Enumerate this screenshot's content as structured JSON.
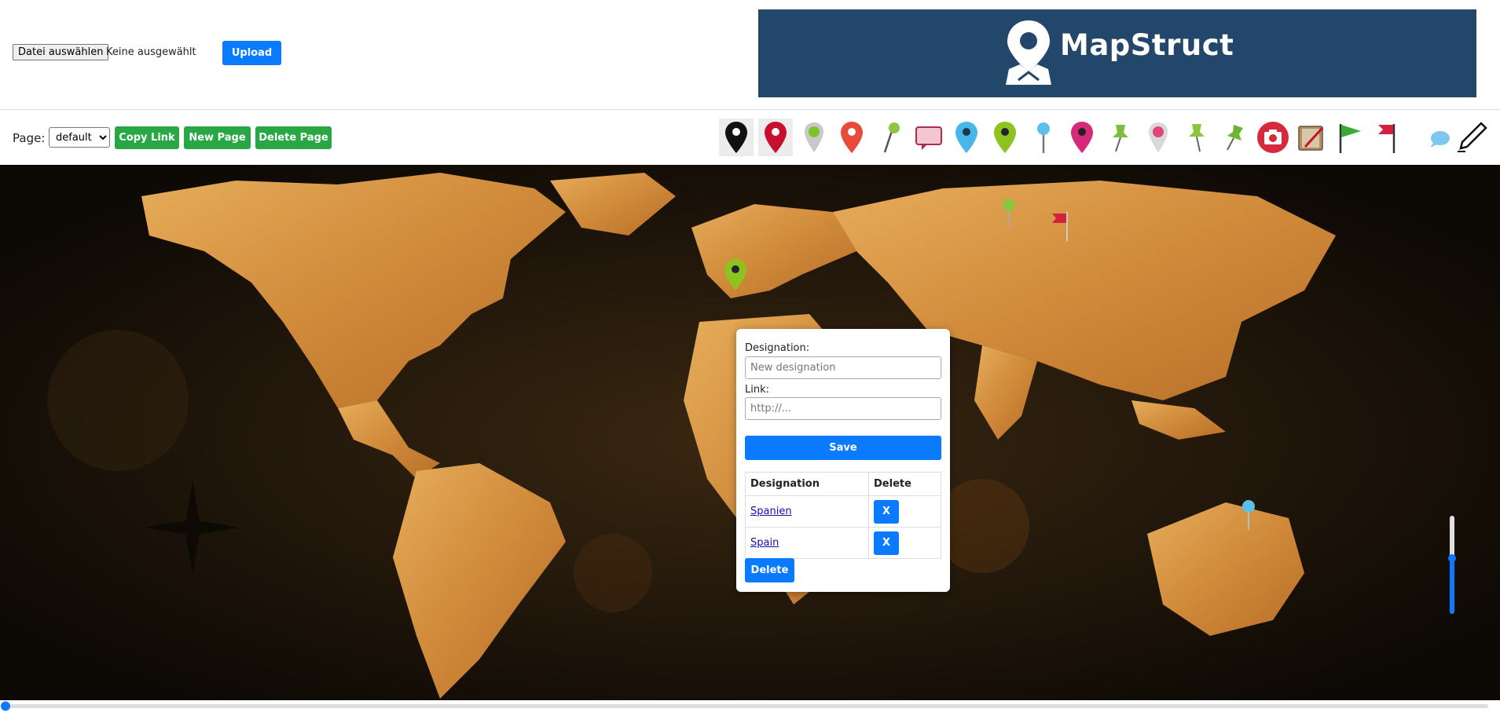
{
  "header": {
    "file_button_label": "Datei auswählen",
    "file_status": "Keine ausgewählt",
    "upload_label": "Upload",
    "brand_name": "MapStruct"
  },
  "toolbar": {
    "page_label": "Page:",
    "page_selected": "default",
    "copy_link_label": "Copy Link",
    "new_page_label": "New Page",
    "delete_page_label": "Delete Page",
    "palette": [
      "black-map-pin-icon",
      "red-map-pin-icon",
      "gray-green-dot-pin-icon",
      "orange-red-map-pin-icon",
      "green-needle-pin-icon",
      "speech-bubble-icon",
      "blue-map-pin-icon",
      "lime-map-pin-icon",
      "blue-needle-pin-icon",
      "magenta-map-pin-icon",
      "green-push-pin-icon",
      "pink-dot-pin-icon",
      "green-push-pin-alt-icon",
      "green-push-pin-tilted-icon",
      "camera-icon",
      "notebook-icon",
      "green-flag-icon",
      "red-flag-icon",
      "blue-comment-icon",
      "pen-icon"
    ]
  },
  "popup": {
    "designation_label": "Designation:",
    "designation_placeholder": "New designation",
    "link_label": "Link:",
    "link_placeholder": "http://...",
    "save_label": "Save",
    "table_headers": [
      "Designation",
      "Delete"
    ],
    "rows": [
      {
        "designation": "Spanien",
        "delete_label": "X"
      },
      {
        "designation": "Spain",
        "delete_label": "X"
      }
    ],
    "delete_label": "Delete"
  },
  "colors": {
    "primary_button": "#0a7bff",
    "success_button": "#28a745",
    "brand_banner": "#22476a",
    "map_land": "#d89a4a",
    "map_ocean": "#1b140b"
  }
}
